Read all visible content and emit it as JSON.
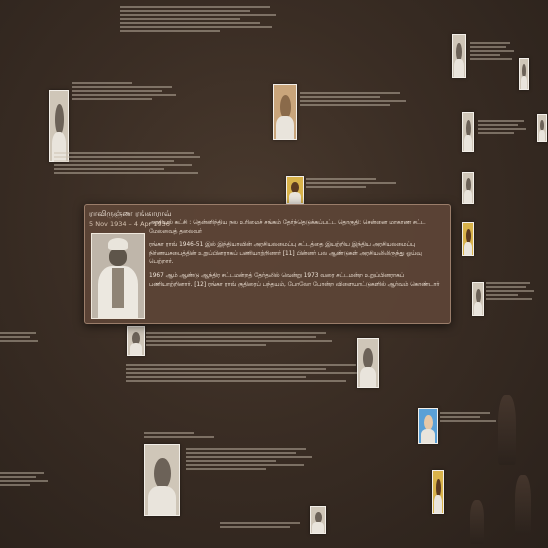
{
  "popup": {
    "name": "ராவிருஞ்ண ரங்காராவ்",
    "dates": "5 Nov 1934 – 4 Apr 1936",
    "paragraphs": [
      "அரசியல் கட்சி : தென்னிந்திய நல உரிமைச் சங்கம் தேர்ந்தெடுக்கப்பட்ட தொகுதி: சென்னை மாகாண சட்ட மேலவைத் தலைவர்",
      "ரங்கா ராவ் 1946-51 இல் இந்தியாவின் அரசியலமைப்பு சட்டத்தை இயற்றிய இந்திய அரசியலமைப்பு நிர்ணயசபைத்தின் உறுப்பினராகப் பணியாற்றினார் [11] பின்னர் பல ஆண்டுகள் அரசியலிலிருந்து ஓய்வு பெற்றார்.",
      "1967 ஆம் ஆண்டு ஆந்திர சட்டமன்றத் தேர்தலில் வென்று 1973 வரை சட்டமன்ற உறுப்பினராகப் பணியாற்றினார். [12] ரங்கா ராவ் குதிரைப் பந்தயம், போலோ போன்ற விளையாட்டுகளில் ஆர்வம் கொண்டார்"
    ]
  },
  "colors": {
    "background": "#3a2d24",
    "popup_bg": "#5c4436",
    "popup_border": "#9a7d6a",
    "text": "#f1e6da"
  }
}
